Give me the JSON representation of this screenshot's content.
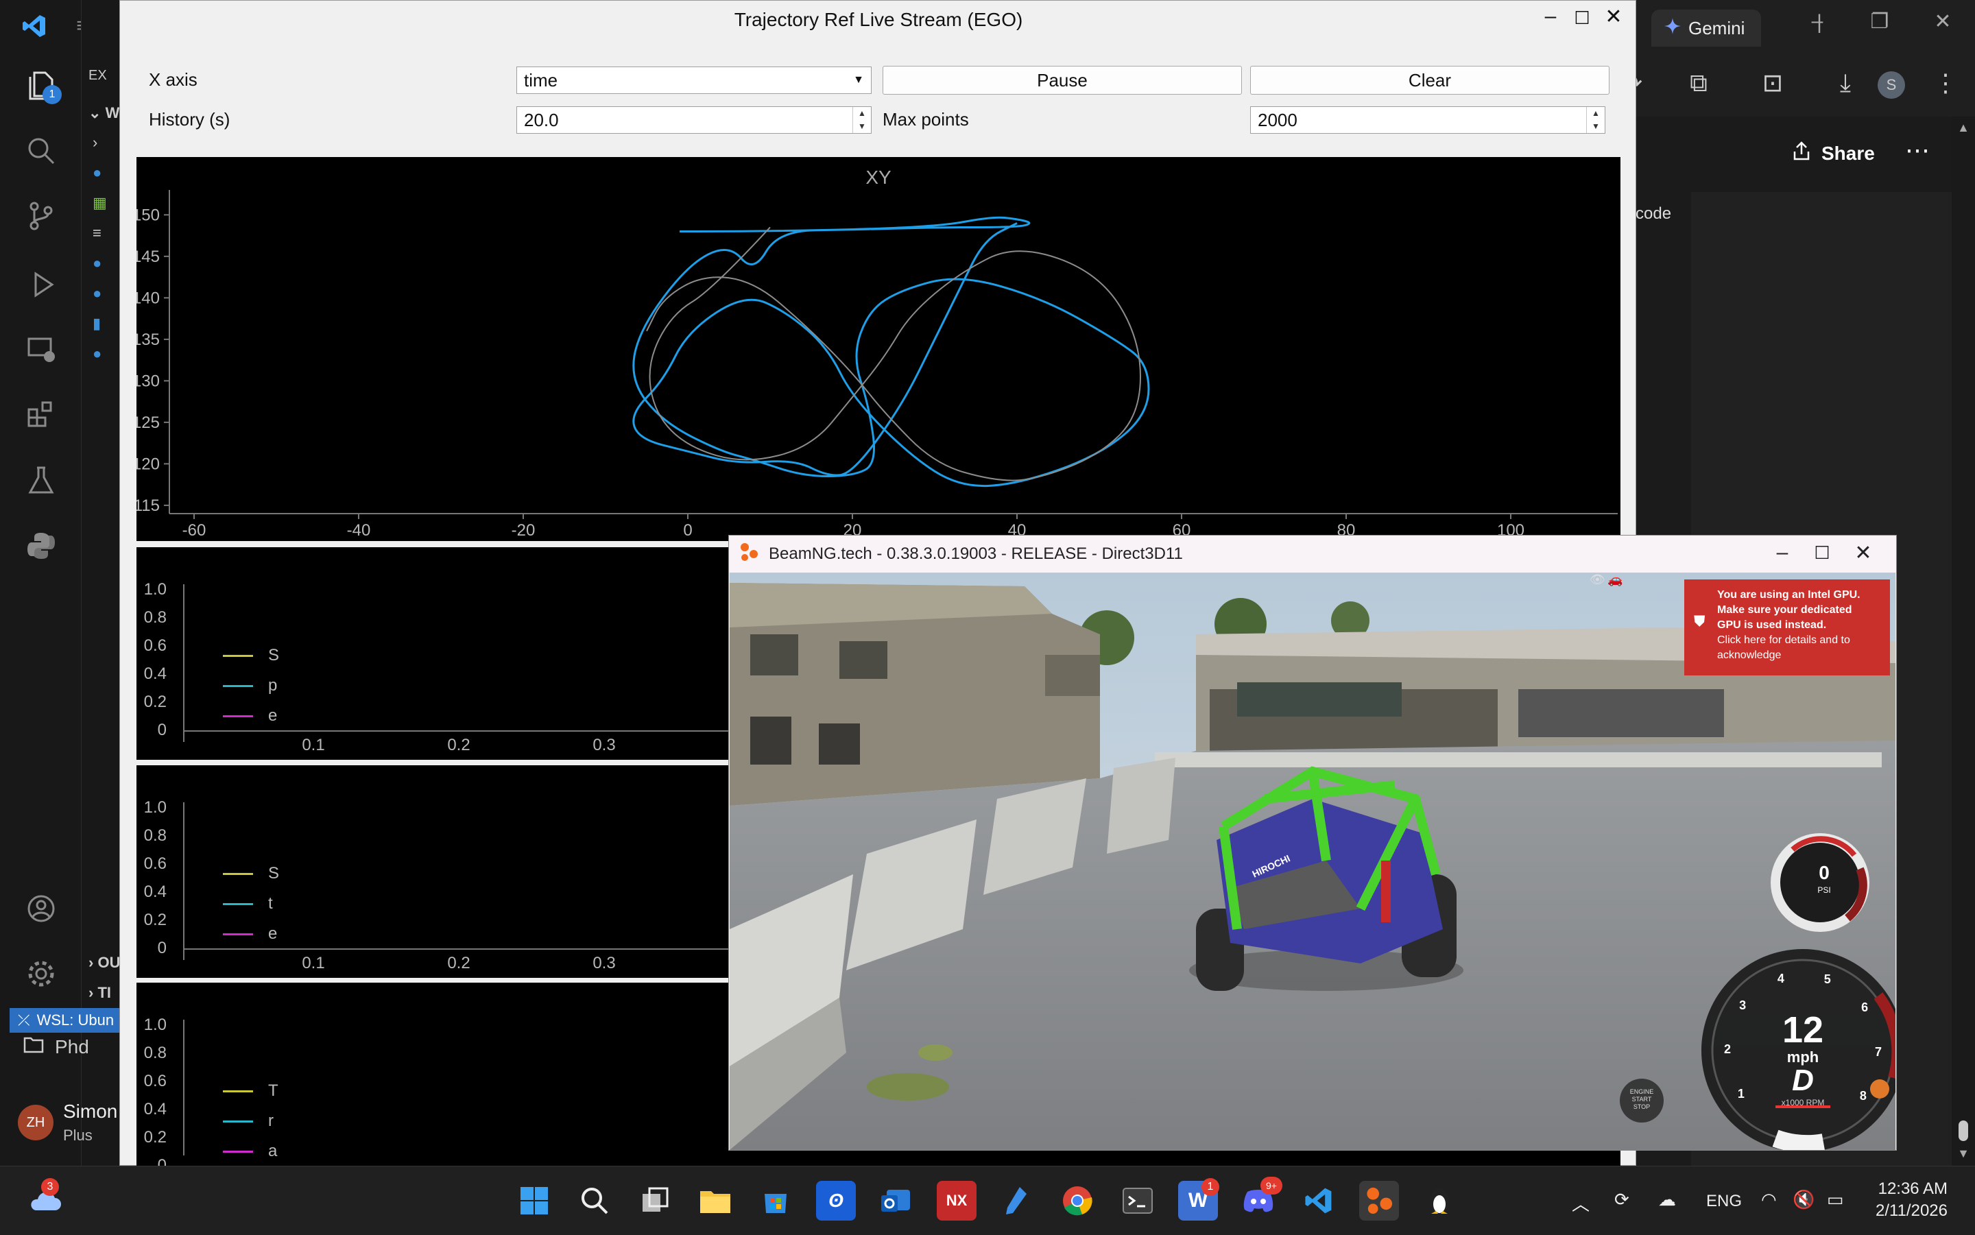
{
  "vscode": {
    "explorer_header": "EX",
    "workspace_prefix": "WI",
    "outline_prefix": "OU",
    "timeline_prefix": "TI",
    "notification_count": "1",
    "wsl_label": "WSL: Ubun",
    "folder_label": "Phd",
    "user": {
      "initials": "ZH",
      "name": "Simon",
      "plan": "Plus"
    }
  },
  "browser": {
    "tab_label": "Gemini",
    "share_label": "Share",
    "avatar_letter": "S",
    "code_label": "code"
  },
  "trajectory_window": {
    "title": "Trajectory Ref Live Stream (EGO)",
    "x_axis_label": "X axis",
    "x_axis_value": "time",
    "pause_label": "Pause",
    "clear_label": "Clear",
    "history_label": "History (s)",
    "history_value": "20.0",
    "max_points_label": "Max points",
    "max_points_value": "2000",
    "xy_plot": {
      "title": "XY",
      "yticks": [
        "150",
        "145",
        "140",
        "135",
        "130",
        "125",
        "120",
        "115"
      ],
      "xticks": [
        "-60",
        "-40",
        "-20",
        "0",
        "20",
        "40",
        "60",
        "80",
        "100"
      ]
    },
    "subplots": [
      {
        "yticks": [
          "1.0",
          "0.8",
          "0.6",
          "0.4",
          "0.2",
          "0"
        ],
        "xticks": [
          "0.1",
          "0.2",
          "0.3"
        ],
        "legend": [
          "S",
          "p",
          "e"
        ]
      },
      {
        "yticks": [
          "1.0",
          "0.8",
          "0.6",
          "0.4",
          "0.2",
          "0"
        ],
        "xticks": [
          "0.1",
          "0.2",
          "0.3"
        ],
        "legend": [
          "S",
          "t",
          "e"
        ]
      },
      {
        "yticks": [
          "1.0",
          "0.8",
          "0.6",
          "0.4",
          "0.2",
          "0"
        ],
        "xticks": [],
        "legend": [
          "T",
          "r",
          "a"
        ]
      }
    ],
    "legend_colors": [
      "#c8c83a",
      "#2ab7c9",
      "#d12ad1"
    ]
  },
  "chart_data": {
    "type": "line",
    "title": "XY",
    "xlabel": "",
    "ylabel": "",
    "xlim": [
      -63,
      113
    ],
    "ylim": [
      114,
      153
    ],
    "series": [
      {
        "color": "#1e9fe8",
        "x": [
          -1,
          10,
          30,
          37,
          40,
          42,
          40,
          30,
          20,
          11,
          8,
          5,
          0,
          -6,
          -7,
          -3,
          4,
          8,
          14,
          20,
          23,
          22,
          20,
          22,
          26,
          33,
          43,
          52,
          56,
          56,
          50,
          40,
          33,
          27,
          20,
          17,
          12,
          7,
          0,
          -3,
          -7,
          -6,
          0,
          6,
          13,
          17,
          20,
          26,
          30,
          33,
          36,
          40
        ],
        "y": [
          148,
          148,
          148.5,
          149.8,
          149.5,
          149,
          148.5,
          148.5,
          148.2,
          148.1,
          143,
          146.5,
          144,
          136,
          130,
          125,
          121.5,
          120.5,
          118.5,
          118.5,
          120,
          127,
          133,
          138.5,
          141,
          142.8,
          140,
          135,
          132,
          126,
          121,
          117.5,
          117.2,
          121,
          128,
          134,
          138.3,
          140.5,
          136,
          130,
          126,
          123,
          121.5,
          120,
          120.5,
          118.5,
          118.8,
          127,
          135,
          141,
          147,
          149
        ]
      },
      {
        "color": "#8c8c8c",
        "x": [
          10,
          3,
          -2,
          -5,
          -4,
          0,
          7,
          15,
          20,
          24,
          27,
          33,
          40,
          50,
          55,
          55,
          50,
          42,
          37,
          30,
          24,
          20,
          14,
          8,
          2,
          -3,
          -5
        ],
        "y": [
          148.5,
          141,
          138,
          132,
          126,
          122,
          120,
          122,
          128,
          133,
          138,
          143,
          146.5,
          143,
          135,
          126,
          121,
          118,
          118,
          120,
          126,
          131,
          137,
          142,
          142.8,
          140,
          136
        ]
      }
    ]
  },
  "beamng": {
    "title": "BeamNG.tech - 0.38.3.0.19003 - RELEASE - Direct3D11",
    "gpu_warning_line1": "You are using an Intel GPU.",
    "gpu_warning_line2": "Make sure your dedicated",
    "gpu_warning_line3": "GPU is used instead.",
    "gpu_warning_line4": "Click here for details and to",
    "gpu_warning_line5": "acknowledge",
    "speed": "12",
    "speed_unit": "mph",
    "gear": "D",
    "rpm_unit": "x1000 RPM",
    "rpm_ticks": [
      "1",
      "2",
      "3",
      "4",
      "5",
      "6",
      "7",
      "8"
    ],
    "boost_value": "0",
    "boost_unit": "PSI",
    "engine_label_1": "ENGINE",
    "engine_label_2": "START",
    "engine_label_3": "STOP",
    "vehicle_brand": "HIROCHI"
  },
  "taskbar": {
    "weather_badge": "3",
    "whiteboard_badge": "1",
    "discord_badge": "9+",
    "language": "ENG",
    "time": "12:36 AM",
    "date": "2/11/2026",
    "nx_label": "NX"
  }
}
